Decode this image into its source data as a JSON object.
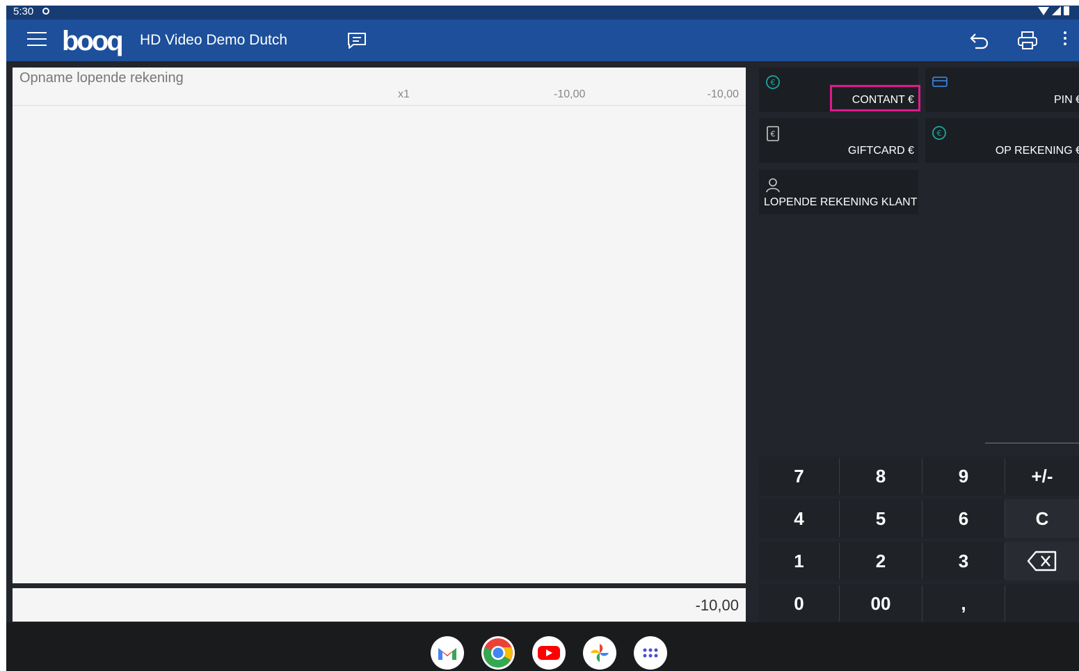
{
  "status_bar": {
    "time": "5:30"
  },
  "app_bar": {
    "logo": "booq",
    "title": "HD Video Demo Dutch"
  },
  "receipt": {
    "title": "Opname lopende rekening",
    "line": {
      "qty": "x1",
      "price": "-10,00",
      "total": "-10,00"
    },
    "grand_total": "-10,00"
  },
  "payment_methods": [
    {
      "label": "CONTANT €",
      "icon": "euro-circle-icon",
      "color": "#1ba79a",
      "highlighted": true
    },
    {
      "label": "PIN €",
      "icon": "card-icon",
      "color": "#3a7fd6"
    },
    {
      "label": "GIFTCARD €",
      "icon": "giftcard-icon",
      "color": "#cccccc"
    },
    {
      "label": "OP REKENING €",
      "icon": "euro-circle-icon",
      "color": "#1ba79a"
    },
    {
      "label": "LOPENDE REKENING KLANT",
      "icon": "person-icon",
      "color": "#cccccc"
    }
  ],
  "keypad": {
    "rows": [
      [
        "7",
        "8",
        "9",
        "+/-"
      ],
      [
        "4",
        "5",
        "6",
        "C"
      ],
      [
        "1",
        "2",
        "3",
        "backspace"
      ],
      [
        "0",
        "00",
        ",",
        ""
      ]
    ]
  },
  "dock": [
    "gmail-icon",
    "chrome-icon",
    "youtube-icon",
    "photos-icon",
    "apps-icon"
  ],
  "colors": {
    "appbar": "#1d4f9a",
    "statusbar": "#173c73",
    "highlight": "#e0198c",
    "panel": "#22262c"
  }
}
